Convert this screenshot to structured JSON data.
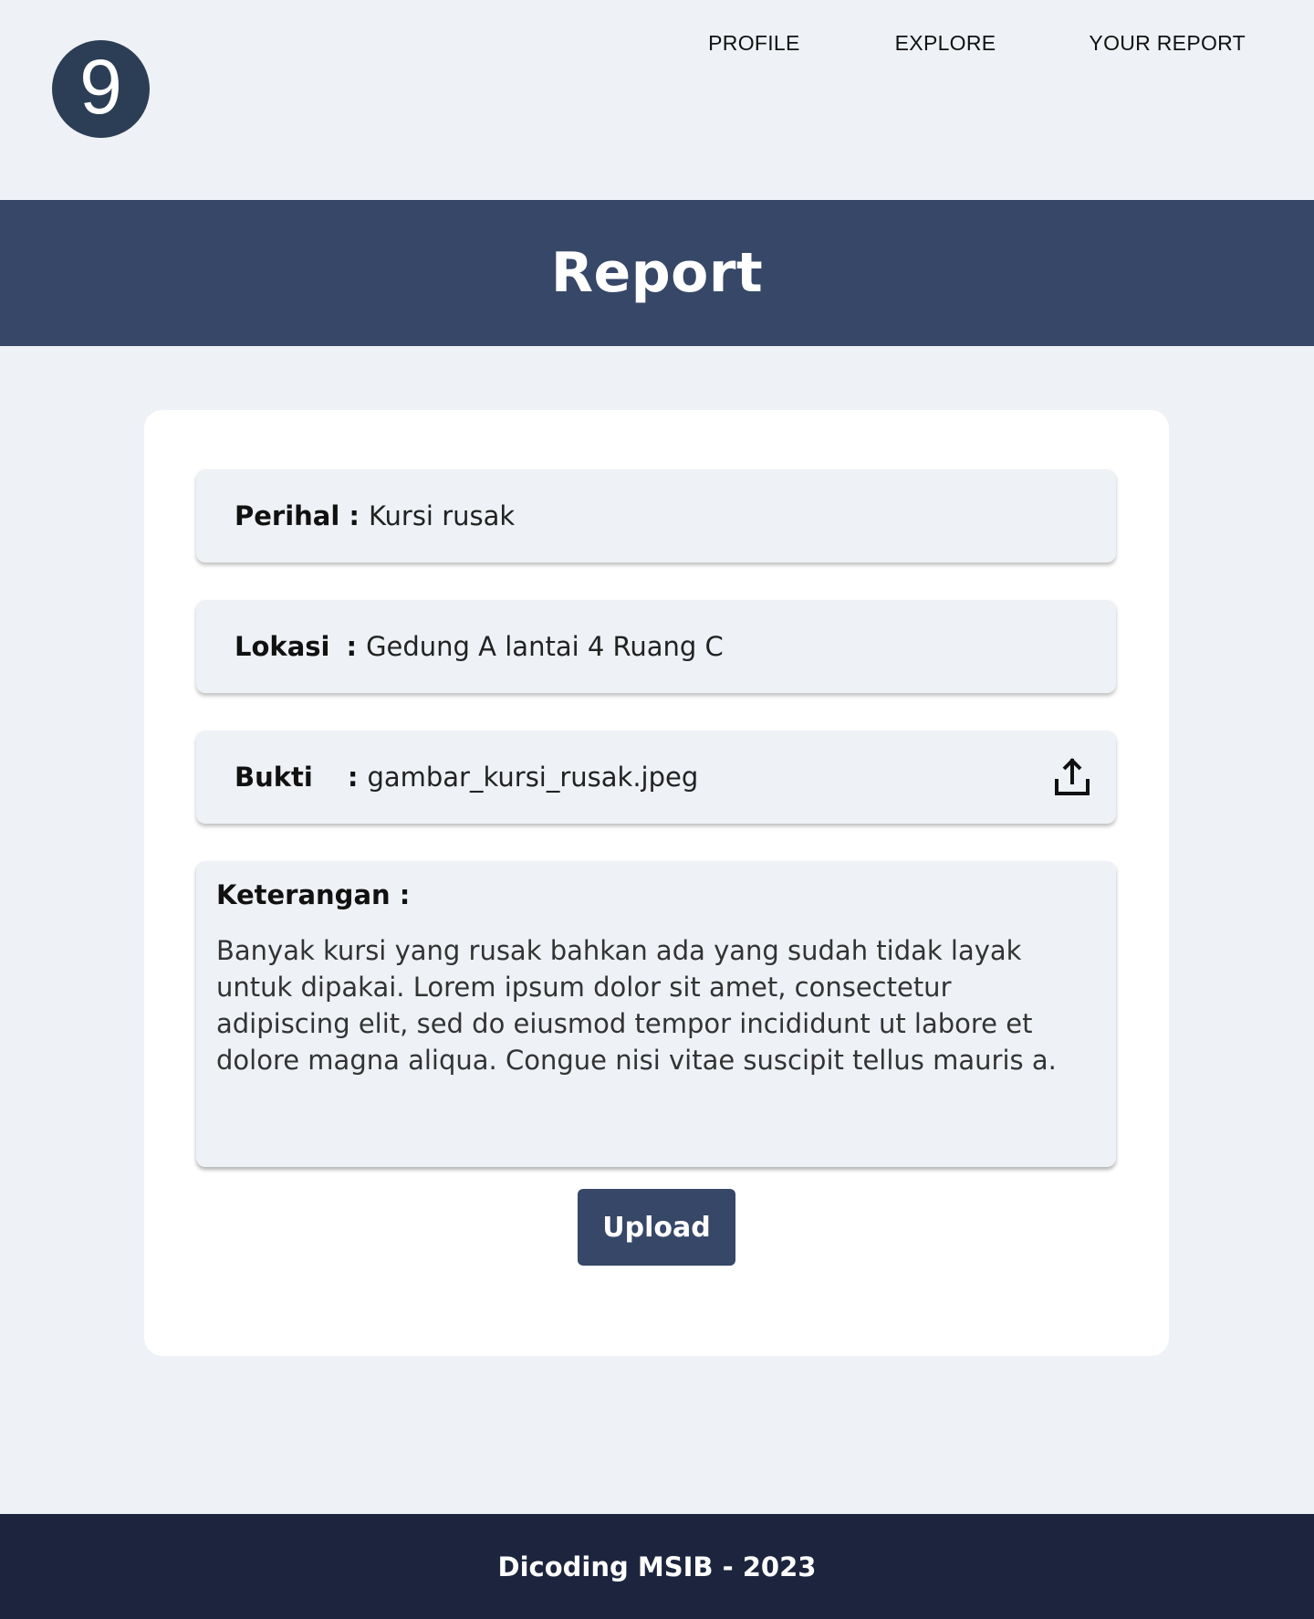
{
  "header": {
    "logo_text": "9",
    "nav": {
      "profile": "PROFILE",
      "explore": "EXPLORE",
      "your_report": "YOUR REPORT"
    }
  },
  "banner": {
    "title": "Report"
  },
  "form": {
    "perihal": {
      "label": "Perihal",
      "separator": ":",
      "value": "Kursi rusak"
    },
    "lokasi": {
      "label": "Lokasi",
      "separator": ":",
      "value": "Gedung A lantai 4 Ruang C"
    },
    "bukti": {
      "label": "Bukti",
      "separator": ":",
      "value": "gambar_kursi_rusak.jpeg",
      "icon": "upload-icon"
    },
    "keterangan": {
      "label": "Keterangan :",
      "value": "Banyak kursi yang rusak bahkan ada yang sudah tidak layak untuk dipakai. Lorem ipsum dolor sit amet, consectetur adipiscing elit, sed do eiusmod tempor incididunt ut labore et dolore magna aliqua. Congue nisi vitae suscipit tellus mauris a."
    },
    "submit_label": "Upload"
  },
  "footer": {
    "text": "Dicoding MSIB - 2023"
  },
  "colors": {
    "background": "#eef1f6",
    "primary": "#364767",
    "logo": "#2c3e55",
    "footer": "#1c253d",
    "card": "#ffffff"
  }
}
